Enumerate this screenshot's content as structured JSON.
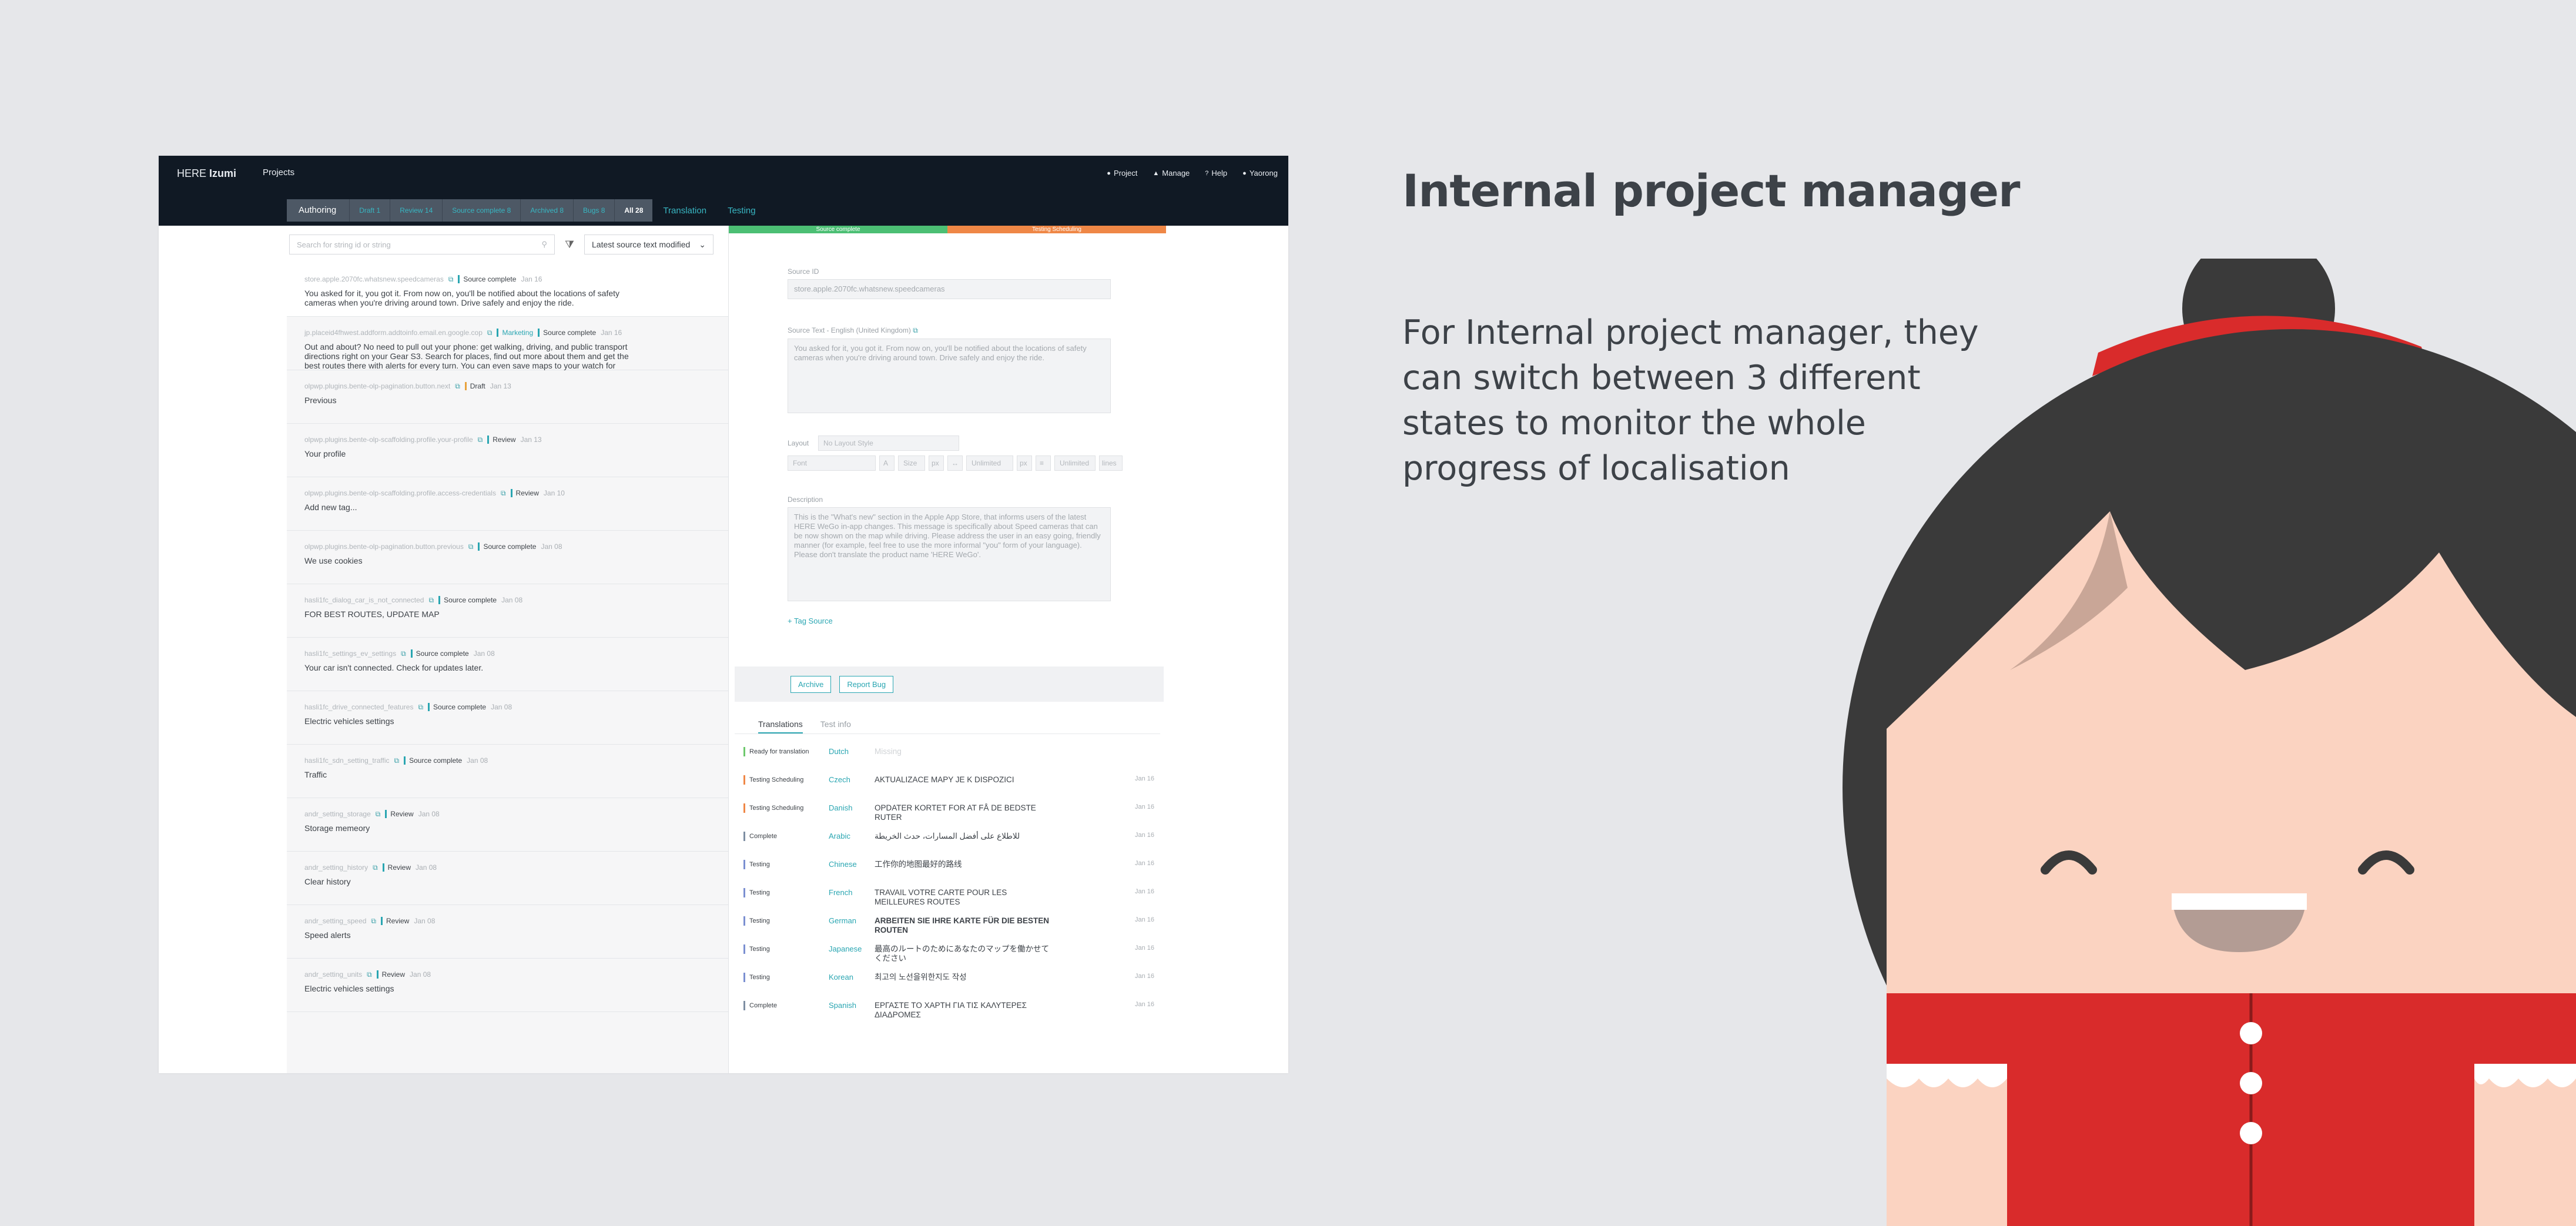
{
  "app": {
    "brand_prefix": "HERE",
    "brand_name": "Izumi",
    "nav_projects": "Projects",
    "top_links": [
      {
        "icon": "gear-icon",
        "glyph": "●",
        "label": "Project"
      },
      {
        "icon": "manage-icon",
        "glyph": "▲",
        "label": "Manage"
      },
      {
        "icon": "help-icon",
        "glyph": "?",
        "label": "Help"
      },
      {
        "icon": "user-icon",
        "glyph": "●",
        "label": "Yaorong"
      }
    ]
  },
  "workflow": {
    "authoring": "Authoring",
    "states": [
      {
        "label": "Draft 1"
      },
      {
        "label": "Review 14"
      },
      {
        "label": "Source complete 8"
      },
      {
        "label": "Archived 8"
      },
      {
        "label": "Bugs 8"
      },
      {
        "label": "All 28",
        "active": true
      }
    ],
    "modes": [
      "Translation",
      "Testing"
    ]
  },
  "list": {
    "search_placeholder": "Search for string id or string",
    "sort_label": "Latest source text modified",
    "items": [
      {
        "key": "store.apple.2070fc.whatsnew.speedcameras",
        "badges": [
          {
            "text": "Source complete",
            "cls": ""
          }
        ],
        "date": "Jan 16",
        "text": "You asked for it, you got it. From now on, you'll be notified about the locations of safety cameras when you're driving around town. Drive safely and enjoy the ride."
      },
      {
        "key": "jp.placeid4fhwest.addform.addtoinfo.email.en.google.cop",
        "badges": [
          {
            "text": "Marketing",
            "cls": "mkt"
          },
          {
            "text": "Source complete",
            "cls": ""
          }
        ],
        "date": "Jan 16",
        "text": "Out and about? No need to pull out your phone: get walking, driving, and public transport directions right on your Gear S3. Search for places, find out more about them and get the best routes there with alerts for every turn. You can even save maps to your watch for offline navigation."
      },
      {
        "key": "olpwp.plugins.bente-olp-pagination.button.next",
        "badges": [
          {
            "text": "Draft",
            "cls": "draft"
          }
        ],
        "date": "Jan 13",
        "text": "Previous"
      },
      {
        "key": "olpwp.plugins.bente-olp-scaffolding.profile.your-profile",
        "badges": [
          {
            "text": "Review",
            "cls": ""
          }
        ],
        "date": "Jan 13",
        "text": "Your profile"
      },
      {
        "key": "olpwp.plugins.bente-olp-scaffolding.profile.access-credentials",
        "badges": [
          {
            "text": "Review",
            "cls": ""
          }
        ],
        "date": "Jan 10",
        "text": "Add new tag..."
      },
      {
        "key": "olpwp.plugins.bente-olp-pagination.button.previous",
        "badges": [
          {
            "text": "Source complete",
            "cls": ""
          }
        ],
        "date": "Jan 08",
        "text": "We use cookies"
      },
      {
        "key": "hasli1fc_dialog_car_is_not_connected",
        "badges": [
          {
            "text": "Source complete",
            "cls": ""
          }
        ],
        "date": "Jan 08",
        "text": "FOR BEST ROUTES, UPDATE MAP"
      },
      {
        "key": "hasli1fc_settings_ev_settings",
        "badges": [
          {
            "text": "Source complete",
            "cls": ""
          }
        ],
        "date": "Jan 08",
        "text": "Your car isn't connected. Check for updates later."
      },
      {
        "key": "hasli1fc_drive_connected_features",
        "badges": [
          {
            "text": "Source complete",
            "cls": ""
          }
        ],
        "date": "Jan 08",
        "text": "Electric vehicles settings"
      },
      {
        "key": "hasli1fc_sdn_setting_traffic",
        "badges": [
          {
            "text": "Source complete",
            "cls": ""
          }
        ],
        "date": "Jan 08",
        "text": "Traffic"
      },
      {
        "key": "andr_setting_storage",
        "badges": [
          {
            "text": "Review",
            "cls": ""
          }
        ],
        "date": "Jan 08",
        "text": "Storage memeory"
      },
      {
        "key": "andr_setting_history",
        "badges": [
          {
            "text": "Review",
            "cls": ""
          }
        ],
        "date": "Jan 08",
        "text": "Clear history"
      },
      {
        "key": "andr_setting_speed",
        "badges": [
          {
            "text": "Review",
            "cls": ""
          }
        ],
        "date": "Jan 08",
        "text": "Speed alerts"
      },
      {
        "key": "andr_setting_units",
        "badges": [
          {
            "text": "Review",
            "cls": ""
          }
        ],
        "date": "Jan 08",
        "text": "Electric vehicles settings"
      }
    ]
  },
  "detail": {
    "stripe": [
      {
        "text": "Source complete",
        "color": "#4cbf74"
      },
      {
        "text": "Testing Scheduling",
        "color": "#ef8746"
      }
    ],
    "source_id_label": "Source ID",
    "source_id": "store.apple.2070fc.whatsnew.speedcameras",
    "source_text_label": "Source Text - English (United Kingdom)",
    "source_text": "You asked for it, you got it. From now on, you'll be notified about the locations of safety cameras when you're driving around town. Drive safely and enjoy the ride.",
    "layout_label": "Layout",
    "layout_value": "No Layout Style",
    "font_placeholder": "Font",
    "size_placeholder": "Size",
    "px1": "px",
    "px2": "px",
    "unlimited": "Unlimited",
    "lines": "lines",
    "description_label": "Description",
    "description": "This is the \"What's new\" section in the Apple App Store, that informs users of the latest HERE WeGo in-app changes. This message is specifically about Speed cameras that can be now shown on the map while driving. Please address the user in an easy going, friendly manner (for example, feel free to use the more informal \"you\" form of your language). Please don't translate the product name 'HERE WeGo'.",
    "tag_source": "+ Tag Source",
    "archive": "Archive",
    "report_bug": "Report Bug",
    "tab_translations": "Translations",
    "tab_testinfo": "Test info",
    "translations": [
      {
        "status": "Ready for translation",
        "cls": "rt",
        "lang": "Dutch",
        "text": "Missing",
        "tcls": "ph",
        "date": ""
      },
      {
        "status": "Testing Scheduling",
        "cls": "ts",
        "lang": "Czech",
        "text": "AKTUALIZACE MAPY JE K DISPOZICI",
        "tcls": "",
        "date": "Jan 16"
      },
      {
        "status": "Testing Scheduling",
        "cls": "ts",
        "lang": "Danish",
        "text": "OPDATER KORTET FOR AT FÅ DE BEDSTE RUTER",
        "tcls": "",
        "date": "Jan 16"
      },
      {
        "status": "Complete",
        "cls": "cp",
        "lang": "Arabic",
        "text": "للاطلاع على أفضل المسارات، حدث الخريطة",
        "tcls": "",
        "date": "Jan 16"
      },
      {
        "status": "Testing",
        "cls": "",
        "lang": "Chinese",
        "text": "工作你的地图最好的路线",
        "tcls": "",
        "date": "Jan 16"
      },
      {
        "status": "Testing",
        "cls": "",
        "lang": "French",
        "text": "TRAVAIL VOTRE CARTE POUR LES MEILLEURES ROUTES",
        "tcls": "",
        "date": "Jan 16"
      },
      {
        "status": "Testing",
        "cls": "",
        "lang": "German",
        "text": "ARBEITEN SIE IHRE KARTE FÜR DIE BESTEN ROUTEN",
        "tcls": "b",
        "date": "Jan 16"
      },
      {
        "status": "Testing",
        "cls": "",
        "lang": "Japanese",
        "text": "最高のルートのためにあなたのマップを働かせてください",
        "tcls": "",
        "date": "Jan 16"
      },
      {
        "status": "Testing",
        "cls": "",
        "lang": "Korean",
        "text": "최고의 노선을위한지도 작성",
        "tcls": "",
        "date": "Jan 16"
      },
      {
        "status": "Complete",
        "cls": "cp",
        "lang": "Spanish",
        "text": "ΕΡΓΑΣΤΕ ΤΟ ΧΑΡΤΗ ΓΙΑ ΤΙΣ ΚΑΛΥΤΕΡΕΣ ΔΙΑΔΡΟΜΕΣ",
        "tcls": "",
        "date": "Jan 16"
      }
    ]
  },
  "slide": {
    "heading": "Internal project manager",
    "paragraph": "For Internal project manager, they can switch between 3 different states to monitor the whole progress of localisation"
  },
  "colors": {
    "accent": "#2aa6b2",
    "topbar": "#101924",
    "mascot_red": "#d92b2b",
    "mascot_skin": "#fbd3c1"
  }
}
